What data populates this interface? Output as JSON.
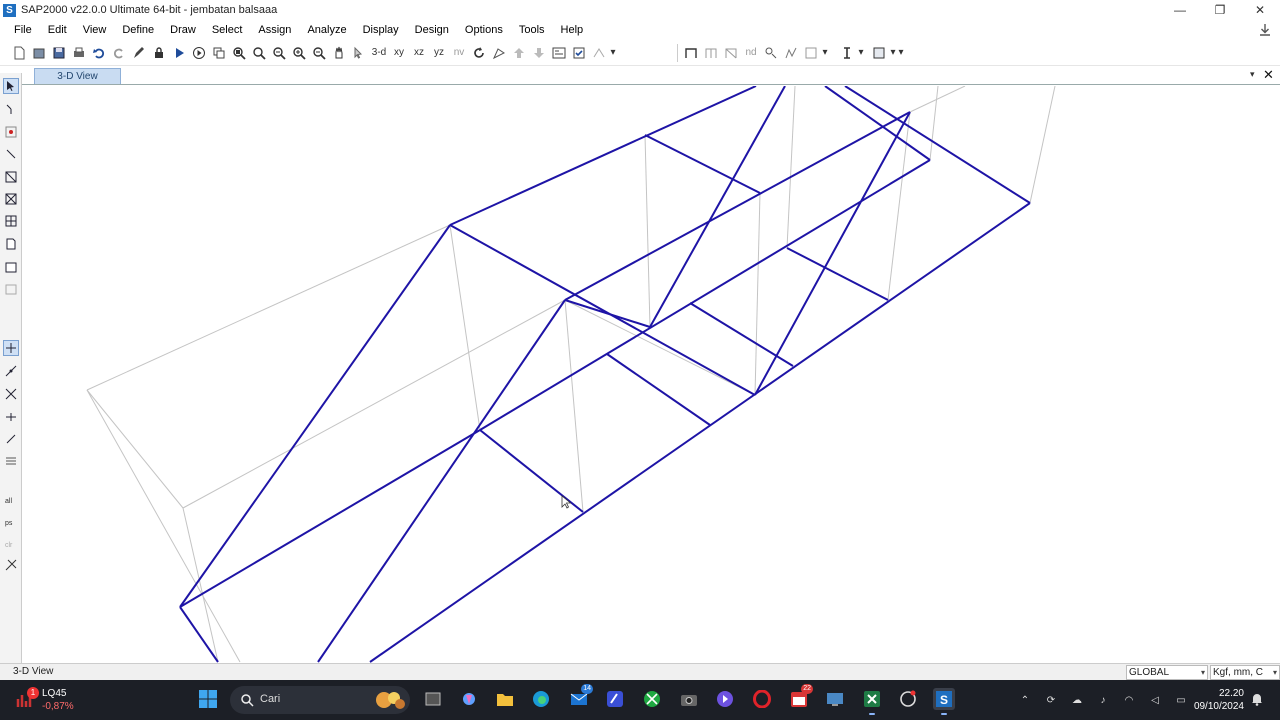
{
  "window": {
    "title": "SAP2000 v22.0.0 Ultimate 64-bit - jembatan balsaaa",
    "app_icon_letter": "S",
    "controls": [
      "—",
      "❐",
      "✕"
    ]
  },
  "menu": {
    "items": [
      "File",
      "Edit",
      "View",
      "Define",
      "Draw",
      "Select",
      "Assign",
      "Analyze",
      "Display",
      "Design",
      "Options",
      "Tools",
      "Help"
    ]
  },
  "toolbar": {
    "view_3d": "3-d",
    "view_xy": "xy",
    "view_xz": "xz",
    "view_yz": "yz",
    "view_nv": "nv",
    "nd_label": "nd"
  },
  "view": {
    "tab_label": "3-D View",
    "dropdown": "▾",
    "close": "✕"
  },
  "status": {
    "left_text": "3-D View",
    "coord_system": "GLOBAL",
    "units": "Kgf, mm, C"
  },
  "taskbar": {
    "stock_name": "LQ45",
    "stock_change": "-0,87%",
    "stock_badge": "1",
    "search_placeholder": "Cari",
    "mail_badge": "14",
    "calendar_badge": "22",
    "clock_time": "22.20",
    "clock_date": "09/10/2024"
  },
  "colors": {
    "frame_members": "#1e14a6",
    "undeformed_lines": "#c4c4c4",
    "tab_bg": "#c9dcf2",
    "taskbar_bg": "#1c1f26"
  }
}
